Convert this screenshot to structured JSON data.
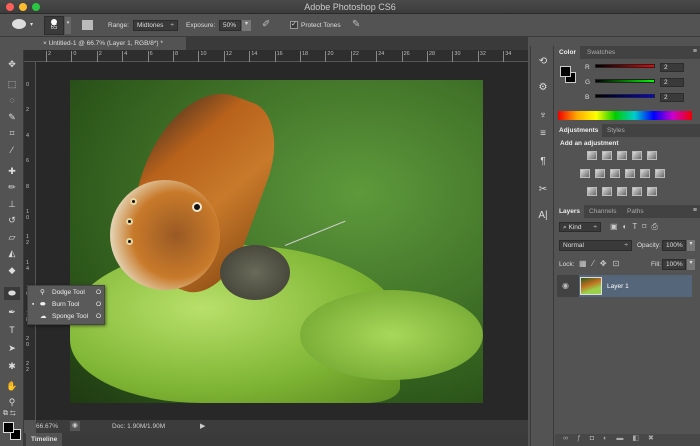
{
  "window": {
    "title": "Adobe Photoshop CS6"
  },
  "options": {
    "brush_size": "65",
    "range_label": "Range:",
    "range_value": "Midtones",
    "exposure_label": "Exposure:",
    "exposure_value": "50%",
    "protect_tones_label": "Protect Tones",
    "protect_tones_checked": true
  },
  "document": {
    "tab_title": "Untitled-1 @ 66.7% (Layer 1, RGB/8*) *"
  },
  "rulers": {
    "top": [
      "2",
      "0",
      "2",
      "4",
      "6",
      "8",
      "10",
      "12",
      "14",
      "16",
      "18",
      "20",
      "22",
      "24",
      "26",
      "28",
      "30",
      "32",
      "34"
    ],
    "left": [
      "0",
      "2",
      "4",
      "6",
      "8",
      "10",
      "12",
      "14",
      "16",
      "18",
      "20",
      "22"
    ]
  },
  "status": {
    "zoom": "66.67%",
    "doc": "Doc: 1.90M/1.90M"
  },
  "timeline": {
    "label": "Timeline"
  },
  "flyout": {
    "items": [
      {
        "label": "Dodge Tool",
        "key": "O",
        "selected": false
      },
      {
        "label": "Burn Tool",
        "key": "O",
        "selected": true
      },
      {
        "label": "Sponge Tool",
        "key": "O",
        "selected": false
      }
    ]
  },
  "color_panel": {
    "tabs": [
      "Color",
      "Swatches"
    ],
    "r_label": "R",
    "g_label": "G",
    "b_label": "B",
    "r": "2",
    "g": "2",
    "b": "2"
  },
  "adjustments_panel": {
    "tabs": [
      "Adjustments",
      "Styles"
    ],
    "heading": "Add an adjustment"
  },
  "layers_panel": {
    "tabs": [
      "Layers",
      "Channels",
      "Paths"
    ],
    "filter": "Kind",
    "blend_mode": "Normal",
    "opacity_label": "Opacity:",
    "opacity": "100%",
    "lock_label": "Lock:",
    "fill_label": "Fill:",
    "fill": "100%",
    "layers": [
      {
        "name": "Layer 1",
        "visible": true,
        "selected": true
      }
    ]
  },
  "colors": {
    "accent_selected_layer": "#56667a",
    "canvas_bg": "#282828",
    "panel_bg": "#535353"
  }
}
